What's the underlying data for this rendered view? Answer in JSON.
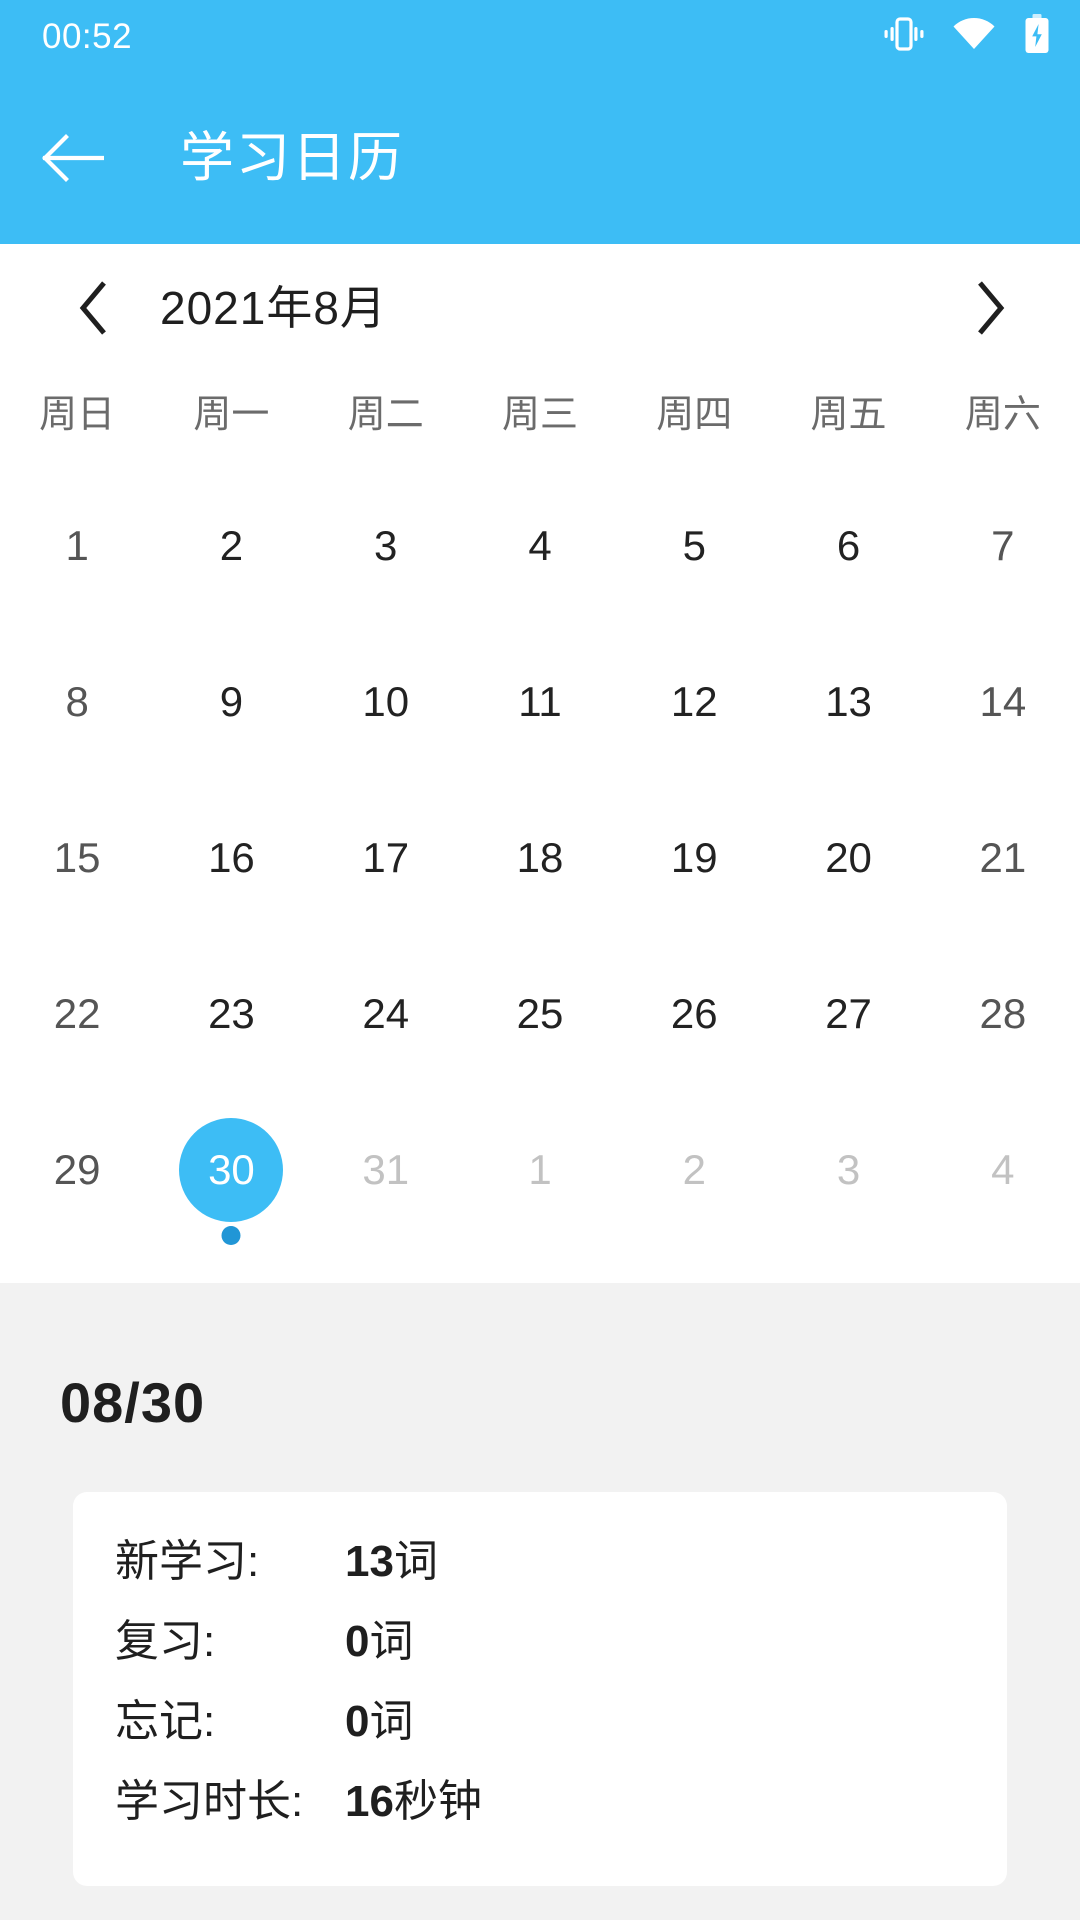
{
  "status_bar": {
    "time": "00:52",
    "icons": [
      "vibrate-icon",
      "wifi-icon",
      "battery-charging-icon"
    ]
  },
  "app_bar": {
    "back_icon": "arrow-left-icon",
    "title": "学习日历"
  },
  "theme": {
    "accent": "#3dbdf5",
    "accent_dark": "#2196d6",
    "page_bg": "#f2f2f2",
    "card_bg": "#ffffff",
    "text_primary": "#222222",
    "text_weekend": "#555555",
    "text_muted": "#c2c2c2",
    "weekday_header": "#6b6b6b"
  },
  "calendar": {
    "prev_icon": "chevron-left-icon",
    "next_icon": "chevron-right-icon",
    "month_label": "2021年8月",
    "year": 2021,
    "month": 8,
    "weekday_headers": [
      "周日",
      "周一",
      "周二",
      "周三",
      "周四",
      "周五",
      "周六"
    ],
    "selected_day": 30,
    "days": [
      {
        "label": "1",
        "state": "weekend"
      },
      {
        "label": "2",
        "state": "normal"
      },
      {
        "label": "3",
        "state": "normal"
      },
      {
        "label": "4",
        "state": "normal"
      },
      {
        "label": "5",
        "state": "normal"
      },
      {
        "label": "6",
        "state": "normal"
      },
      {
        "label": "7",
        "state": "weekend"
      },
      {
        "label": "8",
        "state": "weekend"
      },
      {
        "label": "9",
        "state": "normal"
      },
      {
        "label": "10",
        "state": "normal"
      },
      {
        "label": "11",
        "state": "normal"
      },
      {
        "label": "12",
        "state": "normal"
      },
      {
        "label": "13",
        "state": "normal"
      },
      {
        "label": "14",
        "state": "weekend"
      },
      {
        "label": "15",
        "state": "weekend"
      },
      {
        "label": "16",
        "state": "normal"
      },
      {
        "label": "17",
        "state": "normal"
      },
      {
        "label": "18",
        "state": "normal"
      },
      {
        "label": "19",
        "state": "normal"
      },
      {
        "label": "20",
        "state": "normal"
      },
      {
        "label": "21",
        "state": "weekend"
      },
      {
        "label": "22",
        "state": "weekend"
      },
      {
        "label": "23",
        "state": "normal"
      },
      {
        "label": "24",
        "state": "normal"
      },
      {
        "label": "25",
        "state": "normal"
      },
      {
        "label": "26",
        "state": "normal"
      },
      {
        "label": "27",
        "state": "normal"
      },
      {
        "label": "28",
        "state": "weekend"
      },
      {
        "label": "29",
        "state": "weekend"
      },
      {
        "label": "30",
        "state": "selected",
        "has_dot": true
      },
      {
        "label": "31",
        "state": "muted"
      },
      {
        "label": "1",
        "state": "muted"
      },
      {
        "label": "2",
        "state": "muted"
      },
      {
        "label": "3",
        "state": "muted"
      },
      {
        "label": "4",
        "state": "muted"
      }
    ]
  },
  "stats": {
    "date_title": "08/30",
    "rows": [
      {
        "label": "新学习:",
        "value": "13",
        "unit": "词"
      },
      {
        "label": "复习:",
        "value": "0",
        "unit": "词"
      },
      {
        "label": "忘记:",
        "value": "0",
        "unit": "词"
      },
      {
        "label": "学习时长:",
        "value": "16",
        "unit": "秒钟"
      }
    ]
  }
}
